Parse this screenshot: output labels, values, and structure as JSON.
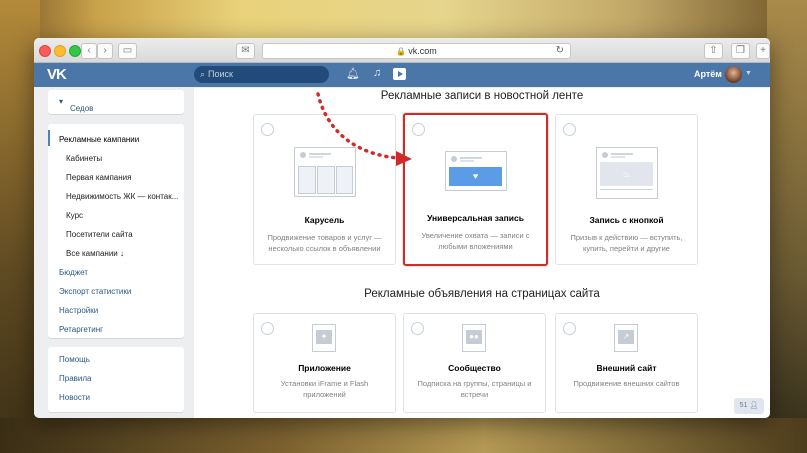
{
  "browser": {
    "url": "vk.com"
  },
  "header": {
    "logo": "VK",
    "search_placeholder": "Поиск",
    "user_name": "Артём"
  },
  "sidebar": {
    "account": "Седов",
    "nav": [
      {
        "label": "Рекламные кампании",
        "type": "main",
        "active": true
      },
      {
        "label": "Кабинеты",
        "type": "sub"
      },
      {
        "label": "Первая кампания",
        "type": "sub"
      },
      {
        "label": "Недвижимость ЖК — контак...",
        "type": "sub"
      },
      {
        "label": "Курс",
        "type": "sub"
      },
      {
        "label": "Посетители сайта",
        "type": "sub"
      },
      {
        "label": "Все кампании ↓",
        "type": "sub"
      },
      {
        "label": "Бюджет",
        "type": "main"
      },
      {
        "label": "Экспорт статистики",
        "type": "main"
      },
      {
        "label": "Настройки",
        "type": "main"
      },
      {
        "label": "Ретаргетинг",
        "type": "main"
      }
    ],
    "help": [
      {
        "label": "Помощь"
      },
      {
        "label": "Правила"
      },
      {
        "label": "Новости"
      }
    ]
  },
  "main": {
    "section1_title": "Рекламные записи в новостной ленте",
    "section1_cards": [
      {
        "title": "Карусель",
        "desc": "Продвижение товаров и услуг — несколько ссылок в объявлении",
        "icon": "carousel-icon",
        "selected": false
      },
      {
        "title": "Универсальная запись",
        "desc": "Увеличение охвата — записи с любыми вложениями",
        "icon": "heart-post-icon",
        "selected": true
      },
      {
        "title": "Запись с кнопкой",
        "desc": "Призыв к действию — вступить, купить, перейти и другие",
        "icon": "fire-post-icon",
        "selected": false
      }
    ],
    "section2_title": "Рекламные объявления на страницах сайта",
    "section2_cards": [
      {
        "title": "Приложение",
        "desc": "Установки iFrame и Flash приложений",
        "icon": "gamepad-icon"
      },
      {
        "title": "Сообщество",
        "desc": "Подписка на группы, страницы и встречи",
        "icon": "community-icon"
      },
      {
        "title": "Внешний сайт",
        "desc": "Продвижение внешних сайтов",
        "icon": "external-link-icon"
      }
    ],
    "counter": "51"
  },
  "colors": {
    "vk_blue": "#4a76a8",
    "link": "#2a5885",
    "selection": "#d12a2a"
  }
}
